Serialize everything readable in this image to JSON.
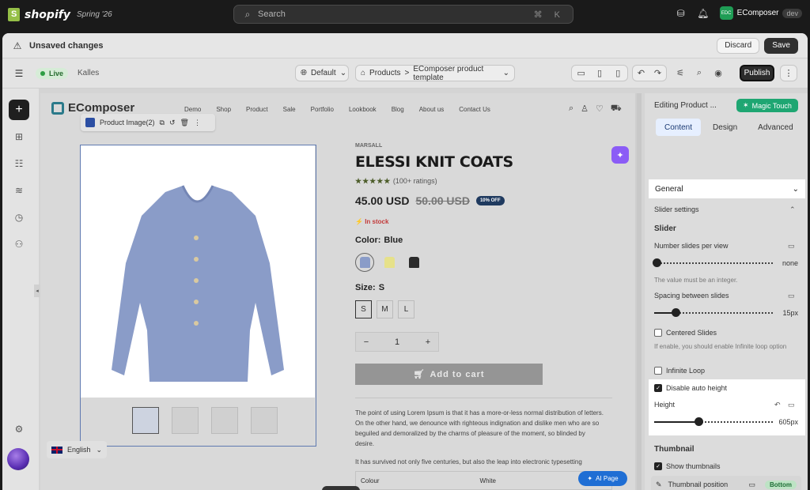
{
  "topbar": {
    "brand": "shopify",
    "edition": "Spring '26",
    "search_placeholder": "Search",
    "search_shortcut": "⌘ K",
    "store_name": "EComposer",
    "store_avatar": "EDC",
    "store_tag": "dev"
  },
  "savebar": {
    "status": "Unsaved changes",
    "discard": "Discard",
    "save": "Save"
  },
  "toolbar": {
    "live": "Live",
    "store": "Kalles",
    "theme": "Default",
    "breadcrumb_root": "Products",
    "breadcrumb_sep": ">",
    "template": "EComposer product template",
    "publish": "Publish"
  },
  "canvas": {
    "brand": "EComposer",
    "menu": [
      "Demo",
      "Shop",
      "Product",
      "Sale",
      "Portfolio",
      "Lookbook",
      "Blog",
      "About us",
      "Contact Us"
    ],
    "element_label": "Product Image(2)",
    "language": "English",
    "vendor": "MARSALL",
    "title": "ELESSI KNIT COATS",
    "stars": "★★★★★",
    "ratings": "(100+ ratings)",
    "price": "45.00 USD",
    "compare_price": "50.00 USD",
    "discount": "10% OFF",
    "stock": "In stock",
    "color_label": "Color:",
    "color_value": "Blue",
    "size_label": "Size:",
    "size_value": "S",
    "sizes": [
      "S",
      "M",
      "L"
    ],
    "qty_minus": "−",
    "qty_value": "1",
    "qty_plus": "+",
    "add_to_cart": "Add to cart",
    "description": "The point of using Lorem Ipsum is that it has a more-or-less normal distribution of letters. On the other hand, we denounce with righteous indignation and dislike men who are so beguiled and demoralized by the charms of pleasure of the moment, so blinded by desire.",
    "description2": "It has survived not only five centuries, but also the leap into electronic typesetting",
    "attr_name": "Colour",
    "attr_value": "White",
    "ai_button": "AI Page"
  },
  "panel": {
    "title": "Editing Product ...",
    "magic": "Magic Touch",
    "tabs": [
      "Content",
      "Design",
      "Advanced"
    ],
    "general": "General",
    "slider_settings": "Slider settings",
    "slider": "Slider",
    "slides_per_view": "Number slides per view",
    "slides_per_view_value": "none",
    "integer_note": "The value must be an integer.",
    "spacing": "Spacing between slides",
    "spacing_value": "15px",
    "spacing_fraction": 0.18,
    "centered": "Centered Slides",
    "centered_note": "If enable, you should enable Infinite loop option",
    "infinite": "Infinite Loop",
    "disable_auto": "Disable auto height",
    "height": "Height",
    "height_value": "605px",
    "height_fraction": 0.37,
    "thumbnail": "Thumbnail",
    "show_thumbs": "Show thumbnails",
    "thumb_position": "Thumbnail position",
    "thumb_position_value": "Bottom"
  },
  "colors": {
    "accent": "#1ea672",
    "primary": "#1f6ed4",
    "swatch_blue": "#8a9cc8",
    "swatch_yellow": "#e6e18a",
    "swatch_black": "#2b2b2b"
  }
}
